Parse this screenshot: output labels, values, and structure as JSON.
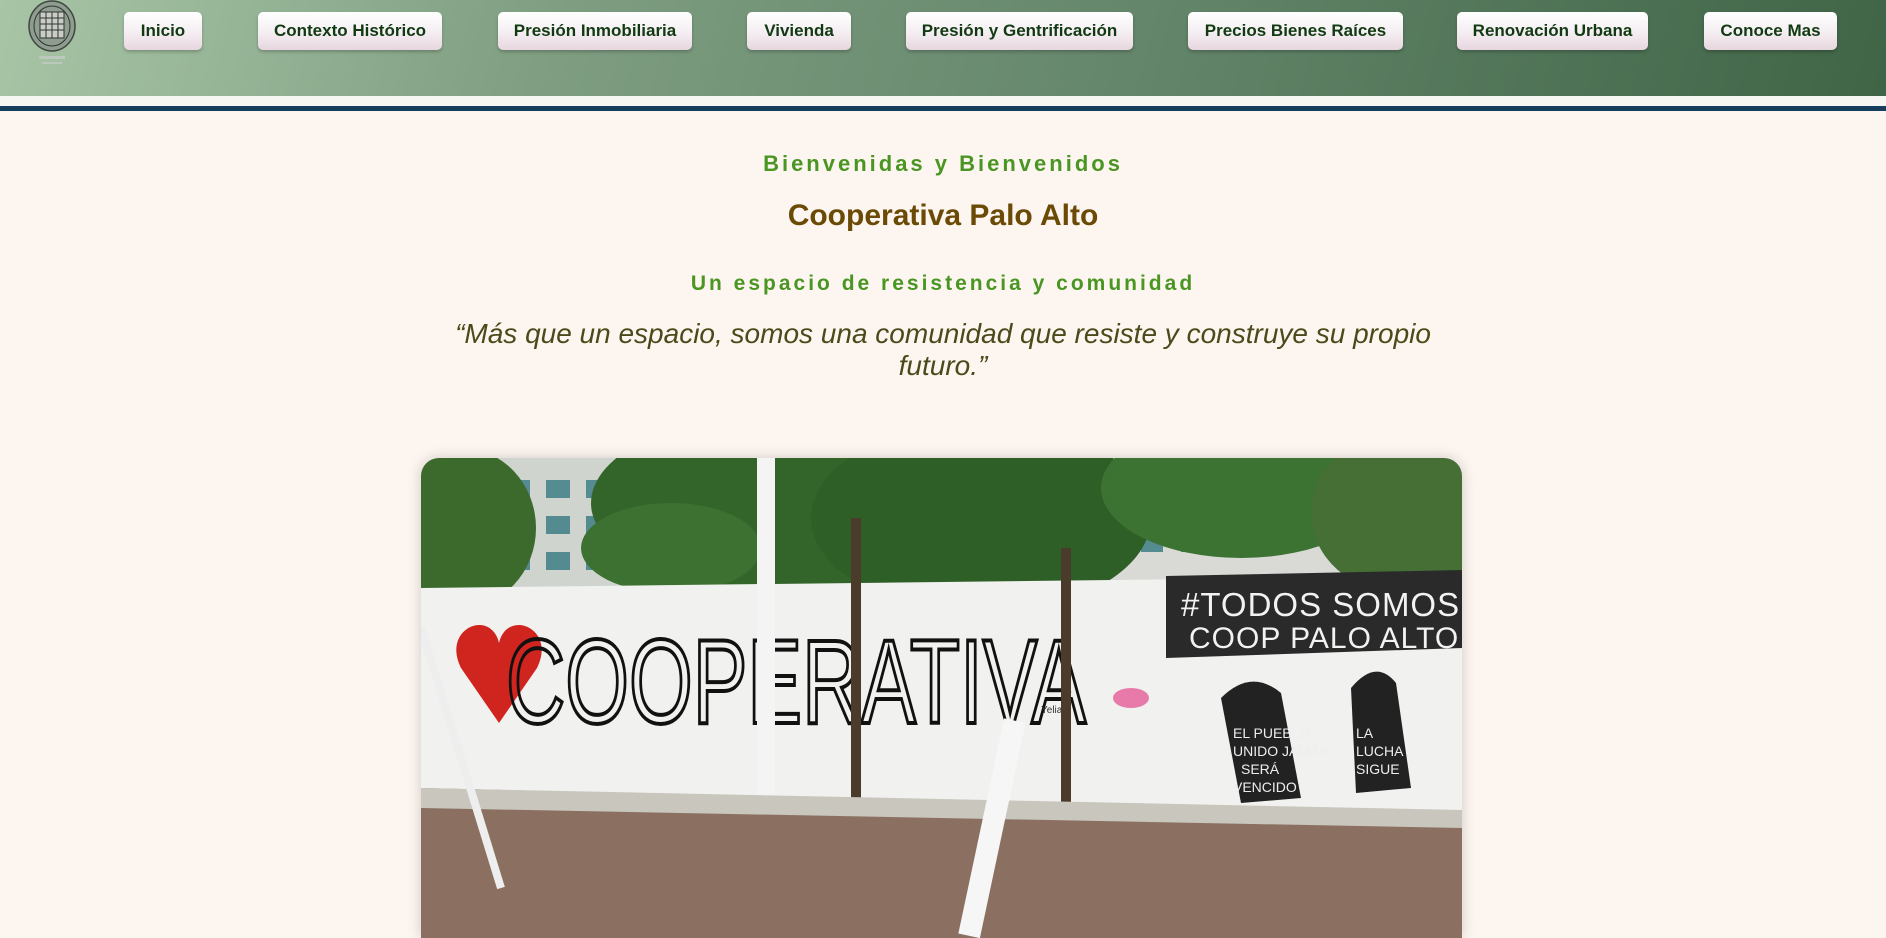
{
  "nav": {
    "items": [
      {
        "label": "Inicio"
      },
      {
        "label": "Contexto Histórico"
      },
      {
        "label": "Presión Inmobiliaria"
      },
      {
        "label": "Vivienda"
      },
      {
        "label": "Presión y Gentrificación"
      },
      {
        "label": "Precios Bienes Raíces"
      },
      {
        "label": "Renovación Urbana"
      },
      {
        "label": "Conoce Mas"
      }
    ]
  },
  "main": {
    "greeting": "Bienvenidas y Bienvenidos",
    "title": "Cooperativa Palo Alto",
    "subtitle": "Un espacio de resistencia y comunidad",
    "quote": "“Más que un espacio, somos una comunidad que resiste y construye su propio futuro.”"
  },
  "photo": {
    "mural_text_main": "COOPERATIVA",
    "mural_text_hashtag": "# TODOS SOMOS COOP PALO ALTO",
    "mural_text_pueblo": "EL PUEBLO UNIDO JAMÁS SERÁ VENCIDO",
    "mural_text_lucha": "LA LUCHA SIGUE",
    "mural_signature": "Yelia"
  },
  "colors": {
    "header_gradient_start": "#a8c5a6",
    "header_gradient_end": "#3f6446",
    "blue_rule": "#153e5c",
    "background": "#fdf5ef",
    "green_text": "#4a9623",
    "title_brown": "#6b4a06",
    "quote_olive": "#4b4a1a",
    "nav_text": "#123a12"
  }
}
